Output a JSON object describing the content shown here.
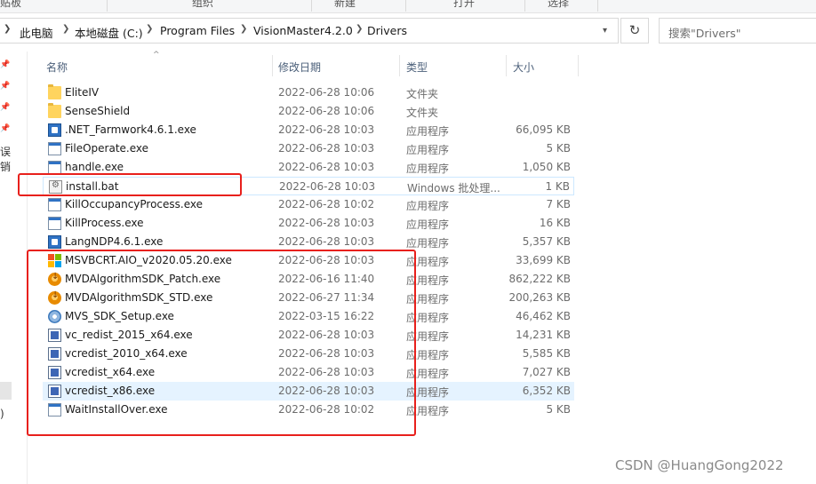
{
  "ribbon": {
    "labels": [
      "贴板",
      "组织",
      "新建",
      "打开",
      "选择"
    ]
  },
  "address": {
    "crumbs": [
      "此电脑",
      "本地磁盘 (C:)",
      "Program Files",
      "VisionMaster4.2.0",
      "Drivers"
    ],
    "search_placeholder": "搜索\"Drivers\""
  },
  "nav": {
    "fragments": [
      "误销",
      ")"
    ]
  },
  "columns": {
    "name": "名称",
    "date": "修改日期",
    "type": "类型",
    "size": "大小"
  },
  "files": [
    {
      "name": "EliteIV",
      "date": "2022-06-28 10:06",
      "type": "文件夹",
      "size": "",
      "icon": "folder-icon"
    },
    {
      "name": "SenseShield",
      "date": "2022-06-28 10:06",
      "type": "文件夹",
      "size": "",
      "icon": "folder-icon"
    },
    {
      "name": ".NET_Farmwork4.6.1.exe",
      "date": "2022-06-28 10:03",
      "type": "应用程序",
      "size": "66,095 KB",
      "icon": "installer-icon"
    },
    {
      "name": "FileOperate.exe",
      "date": "2022-06-28 10:03",
      "type": "应用程序",
      "size": "5 KB",
      "icon": "application-icon"
    },
    {
      "name": "handle.exe",
      "date": "2022-06-28 10:03",
      "type": "应用程序",
      "size": "1,050 KB",
      "icon": "application-icon"
    },
    {
      "name": "install.bat",
      "date": "2022-06-28 10:03",
      "type": "Windows 批处理...",
      "size": "1 KB",
      "icon": "batch-file-icon"
    },
    {
      "name": "KillOccupancyProcess.exe",
      "date": "2022-06-28 10:02",
      "type": "应用程序",
      "size": "7 KB",
      "icon": "application-icon"
    },
    {
      "name": "KillProcess.exe",
      "date": "2022-06-28 10:03",
      "type": "应用程序",
      "size": "16 KB",
      "icon": "application-icon"
    },
    {
      "name": "LangNDP4.6.1.exe",
      "date": "2022-06-28 10:03",
      "type": "应用程序",
      "size": "5,357 KB",
      "icon": "installer-icon"
    },
    {
      "name": "MSVBCRT.AIO_v2020.05.20.exe",
      "date": "2022-06-28 10:03",
      "type": "应用程序",
      "size": "33,699 KB",
      "icon": "microsoft-logo-icon"
    },
    {
      "name": "MVDAlgorithmSDK_Patch.exe",
      "date": "2022-06-16 11:40",
      "type": "应用程序",
      "size": "862,222 KB",
      "icon": "orange-installer-icon"
    },
    {
      "name": "MVDAlgorithmSDK_STD.exe",
      "date": "2022-06-27 11:34",
      "type": "应用程序",
      "size": "200,263 KB",
      "icon": "orange-installer-icon"
    },
    {
      "name": "MVS_SDK_Setup.exe",
      "date": "2022-03-15 16:22",
      "type": "应用程序",
      "size": "46,462 KB",
      "icon": "disc-setup-icon"
    },
    {
      "name": "vc_redist_2015_x64.exe",
      "date": "2022-06-28 10:03",
      "type": "应用程序",
      "size": "14,231 KB",
      "icon": "vc-redist-icon"
    },
    {
      "name": "vcredist_2010_x64.exe",
      "date": "2022-06-28 10:03",
      "type": "应用程序",
      "size": "5,585 KB",
      "icon": "vc-redist-icon"
    },
    {
      "name": "vcredist_x64.exe",
      "date": "2022-06-28 10:03",
      "type": "应用程序",
      "size": "7,027 KB",
      "icon": "vc-redist-icon"
    },
    {
      "name": "vcredist_x86.exe",
      "date": "2022-06-28 10:03",
      "type": "应用程序",
      "size": "6,352 KB",
      "icon": "vc-redist-icon"
    },
    {
      "name": "WaitInstallOver.exe",
      "date": "2022-06-28 10:02",
      "type": "应用程序",
      "size": "5 KB",
      "icon": "application-icon"
    }
  ],
  "watermark": "CSDN @HuangGong2022"
}
